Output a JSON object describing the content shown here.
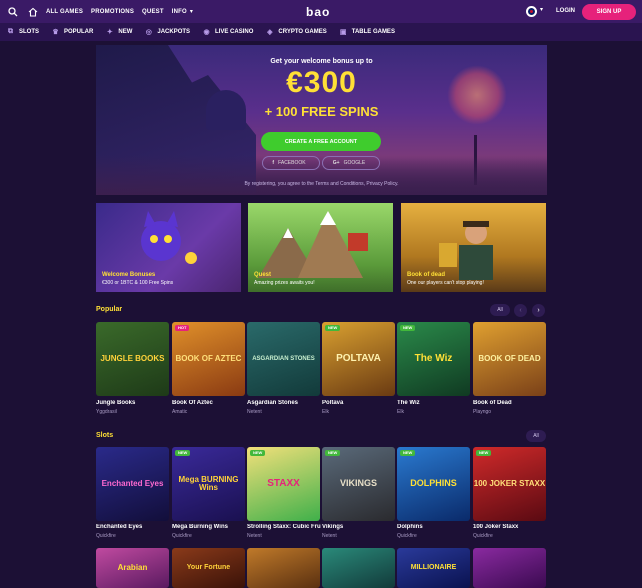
{
  "topbar": {
    "nav": [
      "ALL GAMES",
      "PROMOTIONS",
      "QUEST",
      "INFO"
    ],
    "logo": "bao",
    "login": "LOGIN",
    "signup": "SIGN UP"
  },
  "categories": [
    {
      "label": "SLOTS",
      "icon": "slots-icon"
    },
    {
      "label": "POPULAR",
      "icon": "crown-icon"
    },
    {
      "label": "NEW",
      "icon": "new-icon"
    },
    {
      "label": "JACKPOTS",
      "icon": "jackpot-icon"
    },
    {
      "label": "LIVE CASINO",
      "icon": "live-icon"
    },
    {
      "label": "CRYPTO GAMES",
      "icon": "crypto-icon"
    },
    {
      "label": "TABLE GAMES",
      "icon": "table-icon"
    }
  ],
  "hero": {
    "line1": "Get your welcome bonus up to",
    "amount": "€300",
    "line3": "+ 100 FREE SPINS",
    "cta": "CREATE A FREE ACCOUNT",
    "facebook": "FACEBOOK",
    "google": "GOOGLE",
    "terms": "By registering, you agree to the Terms and Conditions, Privacy Policy."
  },
  "promos": [
    {
      "title": "Welcome Bonuses",
      "sub": "€300 or 1BTC & 100 Free Spins"
    },
    {
      "title": "Quest",
      "sub": "Amazing prizes awaits you!"
    },
    {
      "title": "Book of dead",
      "sub": "One our players can't stop playing!"
    }
  ],
  "popular": {
    "title": "Popular",
    "all": "All",
    "games": [
      {
        "name": "Jungle Books",
        "provider": "Yggdrasil",
        "art": "JUNGLE BOOKS",
        "badge": ""
      },
      {
        "name": "Book Of Aztec",
        "provider": "Amatic",
        "art": "BOOK OF AZTEC",
        "badge": "HOT"
      },
      {
        "name": "Asgardian Stones",
        "provider": "Netent",
        "art": "ASGARDIAN STONES",
        "badge": ""
      },
      {
        "name": "Poltava",
        "provider": "Elk",
        "art": "POLTAVA",
        "badge": "NEW"
      },
      {
        "name": "The Wiz",
        "provider": "Elk",
        "art": "The Wiz",
        "badge": "NEW"
      },
      {
        "name": "Book of Dead",
        "provider": "Playngo",
        "art": "BOOK OF DEAD",
        "badge": ""
      }
    ]
  },
  "slots": {
    "title": "Slots",
    "all": "All",
    "games": [
      {
        "name": "Enchanted Eyes",
        "provider": "Quickfire",
        "art": "Enchanted Eyes",
        "badge": ""
      },
      {
        "name": "Mega Burning Wins",
        "provider": "Quickfire",
        "art": "Mega BURNING Wins",
        "badge": "NEW"
      },
      {
        "name": "Strolling Staxx: Cubic Fruits",
        "provider": "Netent",
        "art": "STAXX",
        "badge": "NEW"
      },
      {
        "name": "Vikings",
        "provider": "Netent",
        "art": "VIKINGS",
        "badge": "NEW"
      },
      {
        "name": "Dolphins",
        "provider": "Quickfire",
        "art": "DOLPHINS",
        "badge": "NEW"
      },
      {
        "name": "100 Joker Staxx",
        "provider": "Quickfire",
        "art": "100 JOKER STAXX",
        "badge": "NEW"
      }
    ]
  },
  "bottom_row": {
    "games": [
      {
        "art": "Arabian",
        "badge": ""
      },
      {
        "art": "Your Fortune",
        "badge": ""
      },
      {
        "art": "",
        "badge": ""
      },
      {
        "art": "",
        "badge": ""
      },
      {
        "art": "MILLIONAIRE",
        "badge": ""
      },
      {
        "art": "",
        "badge": ""
      }
    ]
  },
  "colors": {
    "accent_pink": "#e6227b",
    "cta_green": "#3fcc2d",
    "yellow": "#ffe036",
    "bg": "#1c1035"
  }
}
